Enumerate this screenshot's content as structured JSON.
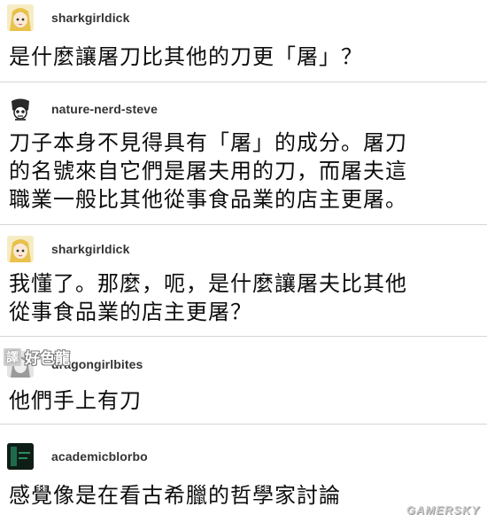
{
  "posts": [
    {
      "username": "sharkgirldick",
      "avatar_icon": "anime-girl-avatar",
      "lines": [
        "是什麼讓屠刀比其他的刀更「屠」？"
      ]
    },
    {
      "username": "nature-nerd-steve",
      "avatar_icon": "skull-drawing-avatar",
      "lines": [
        "刀子本身不見得具有「屠」的成分。屠刀",
        "的名號來自它們是屠夫用的刀，而屠夫這",
        "職業一般比其他從事食品業的店主更屠。"
      ]
    },
    {
      "username": "sharkgirldick",
      "avatar_icon": "anime-girl-avatar",
      "lines": [
        "我懂了。那麼，呃，是什麼讓屠夫比其他",
        "從事食品業的店主更屠？"
      ]
    },
    {
      "username": "dragongirlbites",
      "avatar_icon": "dragon-girl-avatar",
      "lines": [
        "他們手上有刀"
      ]
    },
    {
      "username": "academicblorbo",
      "avatar_icon": "dark-green-avatar",
      "lines": [
        "感覺像是在看古希臘的哲學家討論"
      ]
    }
  ],
  "translator": {
    "label": "譯",
    "name": "好色龍"
  },
  "watermark": "GAMERSKY"
}
